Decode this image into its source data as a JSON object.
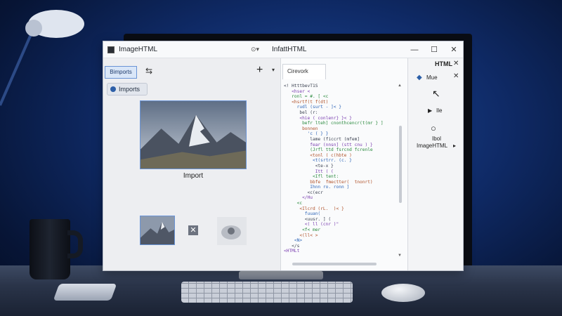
{
  "window": {
    "app_title": "ImageHTML",
    "doc_title": "InfattHTML",
    "minimize": "—",
    "maximize": "☐",
    "close": "✕"
  },
  "left_panel": {
    "tab_label": "Bimports",
    "imports_button": "Imports",
    "image_caption": "Import"
  },
  "code_panel": {
    "tab_label": "Cirevork",
    "lines": [
      "<! HtttbevT1S",
      "   <hser <",
      "   ronl = #. [ <c",
      "   <hsrtf(t f(dt)",
      "     rudl (surt - ]< }",
      "      bel (r:",
      "      <hie ( conlenr} }< }",
      "       befr lteh] cnonthcencr(t(mr } ]",
      "       bonnen",
      "         'c ( } }",
      "          lame (ficcrt (mfem]",
      "          fear (nnsn] (stt cnu ) }",
      "          (Jrfl ttd fsrcnd fcrenle",
      "          <tonl ( c(hbte )",
      "           <t(srtrr. (c. }",
      "            <te-x }",
      "            Itt ( (",
      "           <Ifl tent:",
      "          bbfe  fmectter(  tnonrt)",
      "          Ihnn ro. ronn ]",
      "         <c(ecr",
      "       </Hu",
      "     <c",
      "      <Ilcrd (rL.  )< }",
      "        fuuan(",
      "        <uusr. ] (",
      "        <( ll (cnr )\"",
      "       <f< mer",
      "      <(ll< >",
      "    <N>",
      "   </s",
      "<HTMLt"
    ]
  },
  "right_panel": {
    "header": "HTML",
    "item_1": "Mue",
    "item_3": "Ile",
    "item_4": "Ibol",
    "item_5": "ImageHTML"
  },
  "colors": {
    "accent": "#6a94d6",
    "bg_dark": "#0f2a66"
  }
}
